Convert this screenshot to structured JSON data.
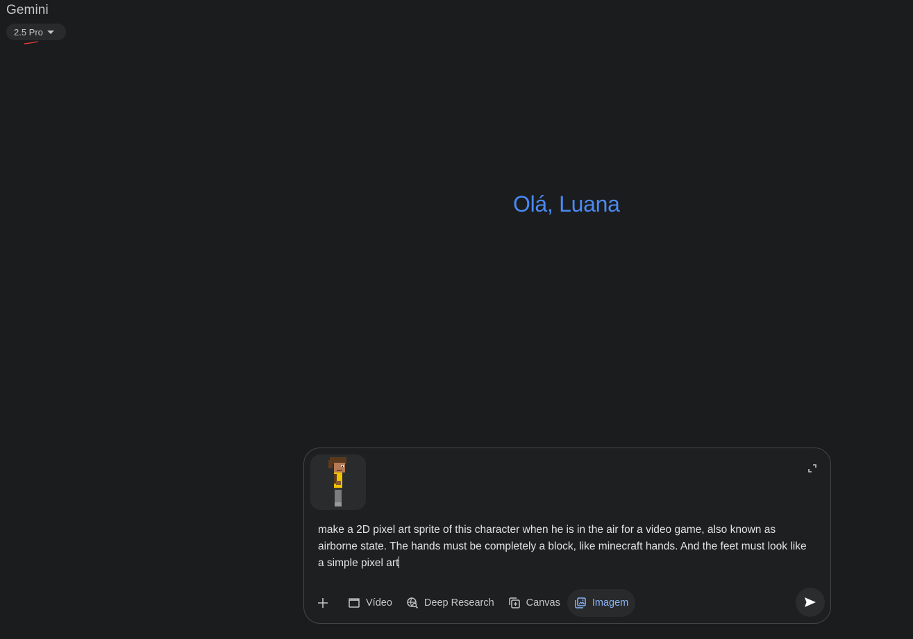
{
  "app": {
    "title": "Gemini",
    "model_label": "2.5 Pro"
  },
  "greeting": "Olá, Luana",
  "composer": {
    "attachment_icon": "character-sprite-thumbnail",
    "prompt_text": "make a 2D pixel art sprite of this character when he is in the air for a video game, also known as airborne state. The hands must be completely a block, like minecraft hands. And the feet must look like a simple pixel art",
    "tools": {
      "video_label": "Vídeo",
      "deep_research_label": "Deep Research",
      "canvas_label": "Canvas",
      "image_label": "Imagem"
    }
  },
  "colors": {
    "background": "#1b1c1d",
    "accent_blue": "#4a89f3",
    "active_tool_text": "#8ab4f8"
  }
}
